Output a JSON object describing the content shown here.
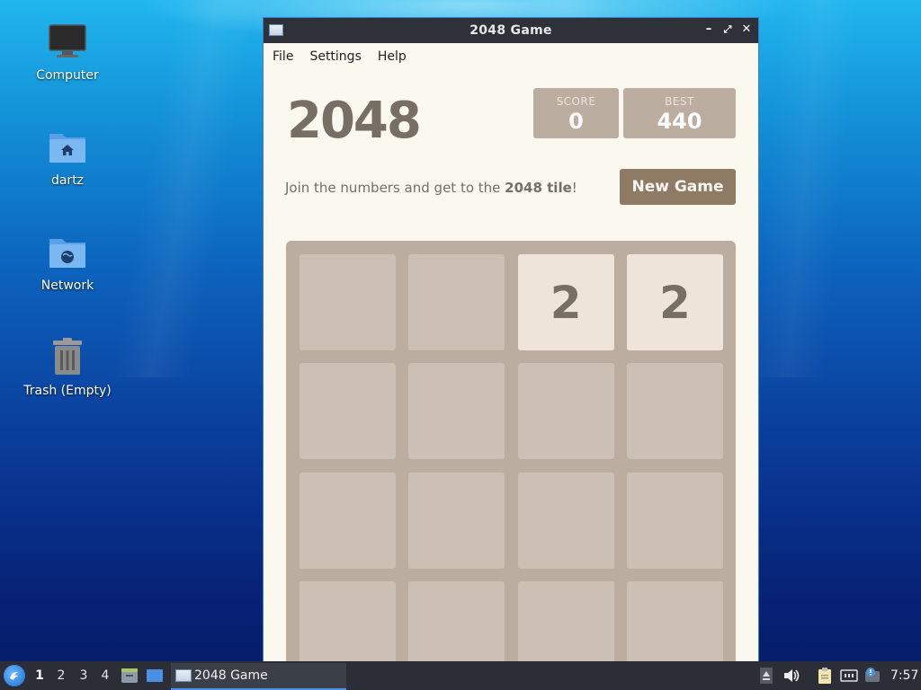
{
  "desktop": {
    "icons": [
      {
        "label": "Computer",
        "icon": "monitor-icon"
      },
      {
        "label": "dartz",
        "icon": "home-folder-icon"
      },
      {
        "label": "Network",
        "icon": "network-folder-icon"
      },
      {
        "label": "Trash (Empty)",
        "icon": "trash-icon"
      }
    ]
  },
  "window": {
    "title": "2048 Game",
    "menu": [
      "File",
      "Settings",
      "Help"
    ],
    "controls": {
      "minimize": "–",
      "maximize": "⤢",
      "close": "✕"
    }
  },
  "game": {
    "title": "2048",
    "score_label": "SCORE",
    "score": "0",
    "best_label": "BEST",
    "best": "440",
    "intro_prefix": "Join the numbers and get to the ",
    "intro_bold": "2048 tile",
    "intro_suffix": "!",
    "new_game_label": "New Game",
    "grid": [
      [
        "",
        "",
        "2",
        "2"
      ],
      [
        "",
        "",
        "",
        ""
      ],
      [
        "",
        "",
        "",
        ""
      ],
      [
        "",
        "",
        "",
        ""
      ]
    ],
    "colors": {
      "board": "#bbada0",
      "tile_2": "#eee4da",
      "text": "#776e65",
      "button": "#8f7a66"
    }
  },
  "taskbar": {
    "workspaces": [
      "1",
      "2",
      "3",
      "4"
    ],
    "active_workspace": "1",
    "task_label": "2048 Game",
    "clock": "7:57"
  }
}
